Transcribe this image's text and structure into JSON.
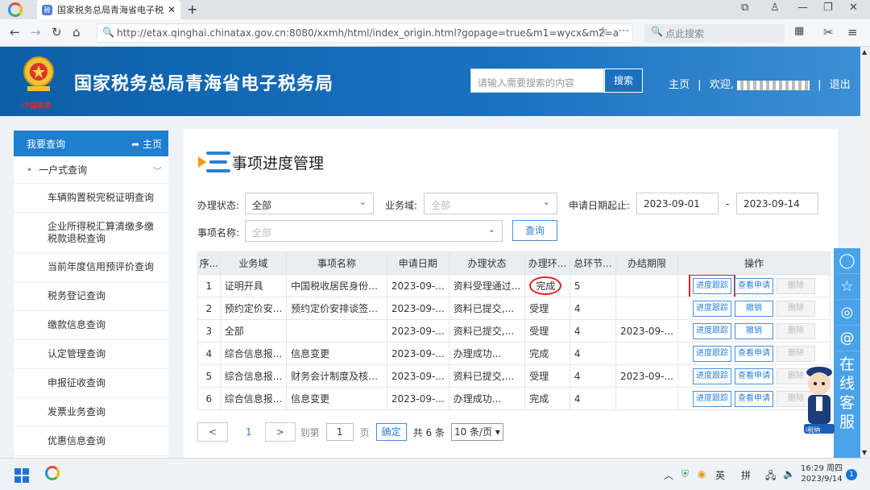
{
  "browser": {
    "tab_title": "国家税务总局青海省电子税务",
    "url": "http://etax.qinghai.chinatax.gov.cn:8080/xxmh/html/index_origin.html?gopage=true&m1=wycx&m2=a",
    "search_placeholder": "点此搜索"
  },
  "header": {
    "site_title": "国家税务总局青海省电子税务局",
    "search_placeholder": "请输入需要搜索的内容",
    "search_button": "搜索",
    "home_link": "主页",
    "welcome": "欢迎,",
    "logout": "退出",
    "emblem_text": "中国税务"
  },
  "sidebar": {
    "title": "我要查询",
    "home": "主页",
    "group": "一户式查询",
    "items": [
      "车辆购置税完税证明查询",
      "企业所得税汇算清缴多缴税款退税查询",
      "当前年度信用预评价查询",
      "税务登记查询",
      "缴款信息查询",
      "认定管理查询",
      "申报征收查询",
      "发票业务查询",
      "优惠信息查询"
    ]
  },
  "main": {
    "title": "事项进度管理",
    "filters": {
      "status_label": "办理状态:",
      "status_value": "全部",
      "domain_label": "业务域:",
      "domain_placeholder": "全部",
      "date_label": "申请日期起止:",
      "date_from": "2023-09-01",
      "date_sep": "-",
      "date_to": "2023-09-14",
      "name_label": "事项名称:",
      "name_placeholder": "全部",
      "query_button": "查询"
    },
    "table": {
      "headers": [
        "序...",
        "业务域",
        "事项名称",
        "申请日期",
        "办理状态",
        "办理环...",
        "总环节...",
        "办结期限",
        "操作"
      ],
      "rows": [
        {
          "no": "1",
          "domain": "证明开具",
          "name": "中国税收居民身份证明",
          "date": "2023-09-...",
          "status": "资料受理通过...",
          "stage": "完成",
          "steps": "5",
          "deadline": "",
          "op2": "查看申请"
        },
        {
          "no": "2",
          "domain": "预约定价安...",
          "name": "预约定价安排谈签申请",
          "date": "2023-09-...",
          "status": "资料已提交,...",
          "stage": "受理",
          "steps": "4",
          "deadline": "",
          "op2": "撤销"
        },
        {
          "no": "3",
          "domain": "全部",
          "name": "",
          "date": "2023-09-...",
          "status": "资料已提交,...",
          "stage": "受理",
          "steps": "4",
          "deadline": "2023-09-...",
          "op2": "撤销"
        },
        {
          "no": "4",
          "domain": "综合信息报...",
          "name": "信息变更",
          "date": "2023-09-...",
          "status": "办理成功...",
          "stage": "完成",
          "steps": "4",
          "deadline": "",
          "op2": "查看申请"
        },
        {
          "no": "5",
          "domain": "综合信息报...",
          "name": "财务会计制度及核算...",
          "date": "2023-09-...",
          "status": "资料已提交,...",
          "stage": "受理",
          "steps": "4",
          "deadline": "2023-09-...",
          "op2": "查看申请"
        },
        {
          "no": "6",
          "domain": "综合信息报...",
          "name": "信息变更",
          "date": "2023-09-...",
          "status": "办理成功...",
          "stage": "完成",
          "steps": "4",
          "deadline": "",
          "op2": "查看申请"
        }
      ],
      "op1": "进度跟踪",
      "op3": "删除"
    },
    "pager": {
      "prev": "<",
      "page": "1",
      "next": ">",
      "goto_label": "到第",
      "goto_value": "1",
      "page_unit": "页",
      "confirm": "确定",
      "total": "共 6 条",
      "page_size": "10 条/页"
    }
  },
  "float": {
    "service": [
      "在",
      "线",
      "客",
      "服"
    ],
    "mascot_label": "i税纳"
  },
  "taskbar": {
    "ime": "英",
    "ime2": "拼",
    "time": "16:29 周四",
    "date": "2023/9/14",
    "badge": "1"
  }
}
